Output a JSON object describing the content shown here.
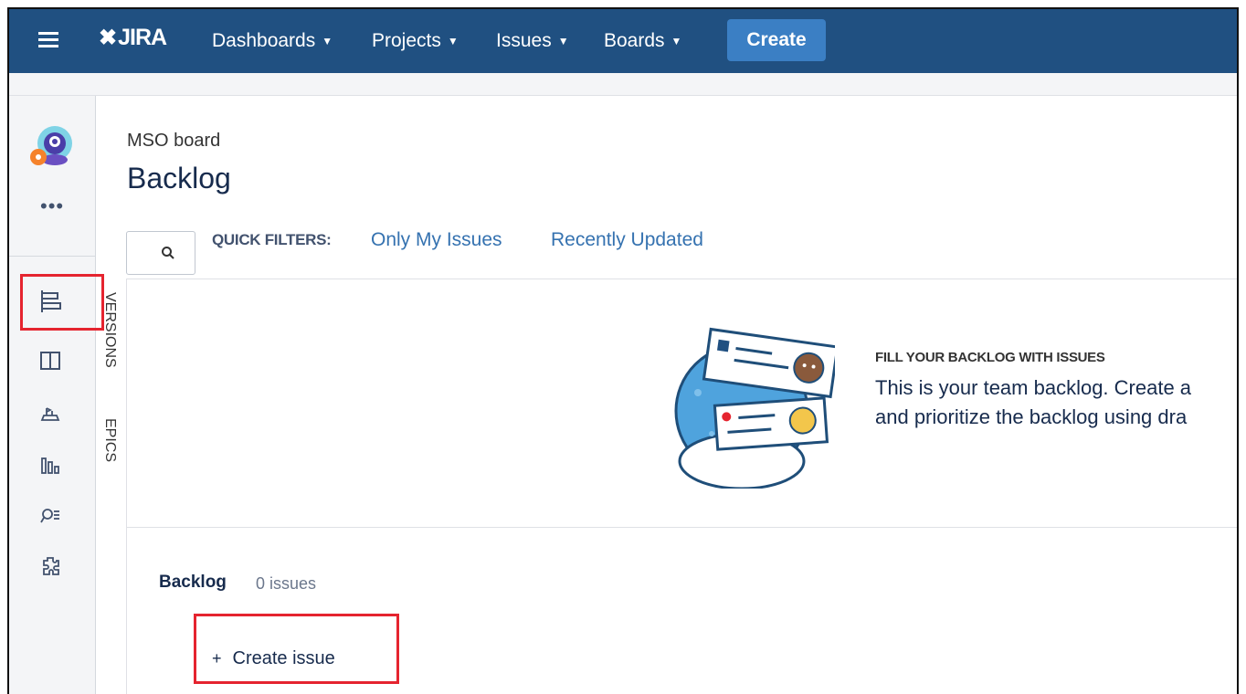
{
  "header": {
    "logo_text": "JIRA",
    "nav": [
      {
        "label": "Dashboards"
      },
      {
        "label": "Projects"
      },
      {
        "label": "Issues"
      },
      {
        "label": "Boards"
      }
    ],
    "create_label": "Create",
    "colors": {
      "bar": "#205081",
      "create": "#3b7fc4"
    }
  },
  "sidebar": {
    "more_label": "•••",
    "items": [
      {
        "icon": "backlog-icon",
        "highlighted": true
      },
      {
        "icon": "board-icon"
      },
      {
        "icon": "releases-icon"
      },
      {
        "icon": "reports-icon"
      },
      {
        "icon": "issues-search-icon"
      },
      {
        "icon": "add-ons-icon"
      }
    ],
    "vertical_tabs": [
      "VERSIONS",
      "EPICS"
    ]
  },
  "main": {
    "board_name": "MSO board",
    "title": "Backlog",
    "quick_filters_label": "QUICK FILTERS:",
    "quick_filters": [
      "Only My Issues",
      "Recently Updated"
    ],
    "empty_state": {
      "title": "FILL YOUR BACKLOG WITH ISSUES",
      "line1": "This is your team backlog. Create a",
      "line2": "and prioritize the backlog using dra"
    },
    "backlog": {
      "label": "Backlog",
      "count": "0 issues",
      "create_issue": "Create issue"
    }
  },
  "annotation_color": "#e5242f"
}
